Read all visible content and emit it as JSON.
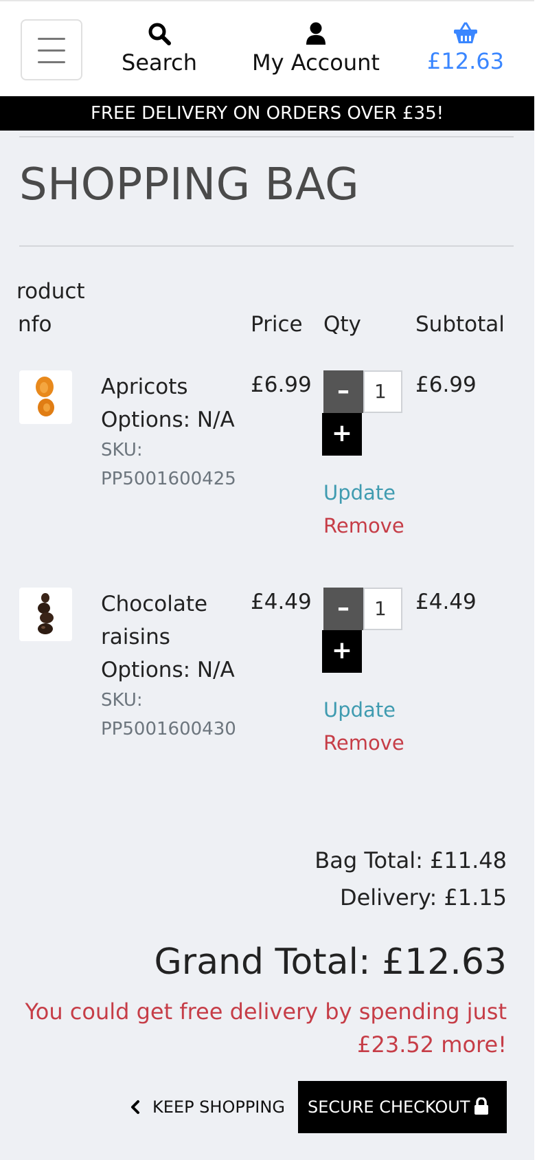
{
  "header": {
    "menu_icon": "hamburger-icon",
    "search_label": "Search",
    "account_label": "My Account",
    "bag_total": "£12.63",
    "accent_color": "#3a86ff"
  },
  "banner": {
    "text": "FREE DELIVERY ON ORDERS OVER £35!"
  },
  "page": {
    "title": "SHOPPING BAG"
  },
  "table": {
    "headers": {
      "product_line1": "roduct",
      "product_line2": "nfo",
      "price": "Price",
      "qty": "Qty",
      "subtotal": "Subtotal"
    }
  },
  "items": [
    {
      "name": "Apricots",
      "options": "Options: N/A",
      "sku_label": "SKU:",
      "sku": "PP5001600425",
      "price": "£6.99",
      "qty": "1",
      "subtotal": "£6.99",
      "update_label": "Update",
      "remove_label": "Remove"
    },
    {
      "name": "Chocolate raisins",
      "options": "Options: N/A",
      "sku_label": "SKU:",
      "sku": "PP5001600430",
      "price": "£4.49",
      "qty": "1",
      "subtotal": "£4.49",
      "update_label": "Update",
      "remove_label": "Remove"
    }
  ],
  "totals": {
    "bag_total": "Bag Total: £11.48",
    "delivery": "Delivery: £1.15",
    "grand_total": "Grand Total: £12.63",
    "free_delivery_msg": "You could get free delivery by spending just £23.52 more!"
  },
  "actions": {
    "keep_shopping": "KEEP SHOPPING",
    "secure_checkout": "SECURE CHECKOUT"
  }
}
